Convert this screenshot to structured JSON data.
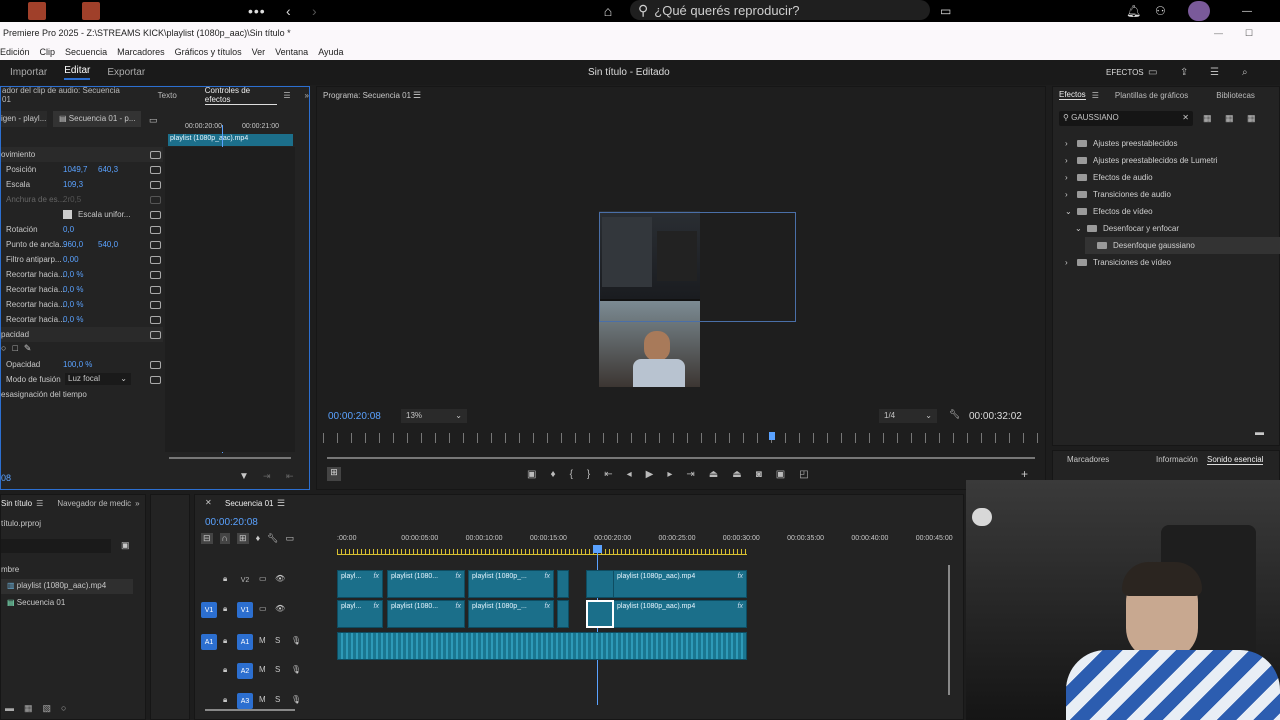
{
  "spotify": {
    "search_placeholder": "¿Qué querés reproducir?"
  },
  "window": {
    "title": "Premiere Pro 2025 - Z:\\STREAMS KICK\\playlist (1080p_aac)\\Sin título *"
  },
  "menu": [
    "Edición",
    "Clip",
    "Secuencia",
    "Marcadores",
    "Gráficos y títulos",
    "Ver",
    "Ventana",
    "Ayuda"
  ],
  "workspace": {
    "tabs": [
      "Importar",
      "Editar",
      "Exportar"
    ],
    "active": "Editar",
    "doc_title": "Sin título - Editado",
    "effects_label": "EFECTOS"
  },
  "effect_controls": {
    "tabs": [
      "ador del clip de audio: Secuencia 01",
      "Texto",
      "Controles de efectos"
    ],
    "source_label": "igen - playl...",
    "seq_label": "Secuencia 01 - p...",
    "timecodes": [
      "00:00:20:00",
      "00:00:21:00"
    ],
    "clip_label": "playlist (1080p_aac).mp4",
    "rows": [
      {
        "label": "ovimiento",
        "v1": "",
        "v2": ""
      },
      {
        "label": "Posición",
        "v1": "1049,7",
        "v2": "640,3"
      },
      {
        "label": "Escala",
        "v1": "109,3",
        "v2": ""
      },
      {
        "label": "Anchura de es...",
        "v1": "2r0,5",
        "v2": ""
      },
      {
        "label": "Escala unifor...",
        "v1": "",
        "v2": ""
      },
      {
        "label": "Rotación",
        "v1": "0,0",
        "v2": ""
      },
      {
        "label": "Punto de ancla...",
        "v1": "960,0",
        "v2": "540,0"
      },
      {
        "label": "Filtro antiparp...",
        "v1": "0,00",
        "v2": ""
      },
      {
        "label": "Recortar hacia...",
        "v1": "0,0 %",
        "v2": ""
      },
      {
        "label": "Recortar hacia...",
        "v1": "0,0 %",
        "v2": ""
      },
      {
        "label": "Recortar hacia...",
        "v1": "0,0 %",
        "v2": ""
      },
      {
        "label": "Recortar hacia...",
        "v1": "0,0 %",
        "v2": ""
      },
      {
        "label": "pacidad",
        "v1": "",
        "v2": ""
      }
    ],
    "opacity_label": "Opacidad",
    "opacity_value": "100,0 %",
    "blend_label": "Modo de fusión",
    "blend_value": "Luz focal",
    "time_remap": "esasignación del tiempo",
    "bottom_tc": "08"
  },
  "program": {
    "title": "Programa: Secuencia 01",
    "timecode": "00:00:20:08",
    "zoom": "13%",
    "quality": "1/4",
    "duration": "00:00:32:02"
  },
  "effects_panel": {
    "tabs": [
      "Efectos",
      "Plantillas de gráficos",
      "Bibliotecas"
    ],
    "search": "GAUSSIANO",
    "tree": [
      "Ajustes preestablecidos",
      "Ajustes preestablecidos de Lumetri",
      "Efectos de audio",
      "Transiciones de audio",
      "Efectos de vídeo",
      "Desenfocar y enfocar",
      "Desenfoque gaussiano",
      "Transiciones de vídeo"
    ],
    "bottom_tabs": [
      "Marcadores",
      "Información",
      "Sonido esencial"
    ]
  },
  "project": {
    "tabs": [
      "Sin título",
      "Navegador de medic"
    ],
    "file": "título.prproj",
    "name_header": "mbre",
    "items": [
      "playlist (1080p_aac).mp4",
      "Secuencia 01"
    ]
  },
  "timeline": {
    "tab": "Secuencia 01",
    "timecode": "00:00:20:08",
    "ruler": [
      ":00:00",
      "00:00:05:00",
      "00:00:10:00",
      "00:00:15:00",
      "00:00:20:00",
      "00:00:25:00",
      "00:00:30:00",
      "00:00:35:00",
      "00:00:40:00",
      "00:00:45:00"
    ],
    "tracks": [
      "V2",
      "V1",
      "A1",
      "A2",
      "A3"
    ],
    "clips_v2": [
      "playl...",
      "playlist (1080...",
      "playlist (1080p_...",
      "playlist (1080p_aac).mp4"
    ],
    "clips_v1": [
      "playl...",
      "playlist (1080...",
      "playlist (1080p_...",
      "playlist (1080p_aac).mp4"
    ]
  }
}
